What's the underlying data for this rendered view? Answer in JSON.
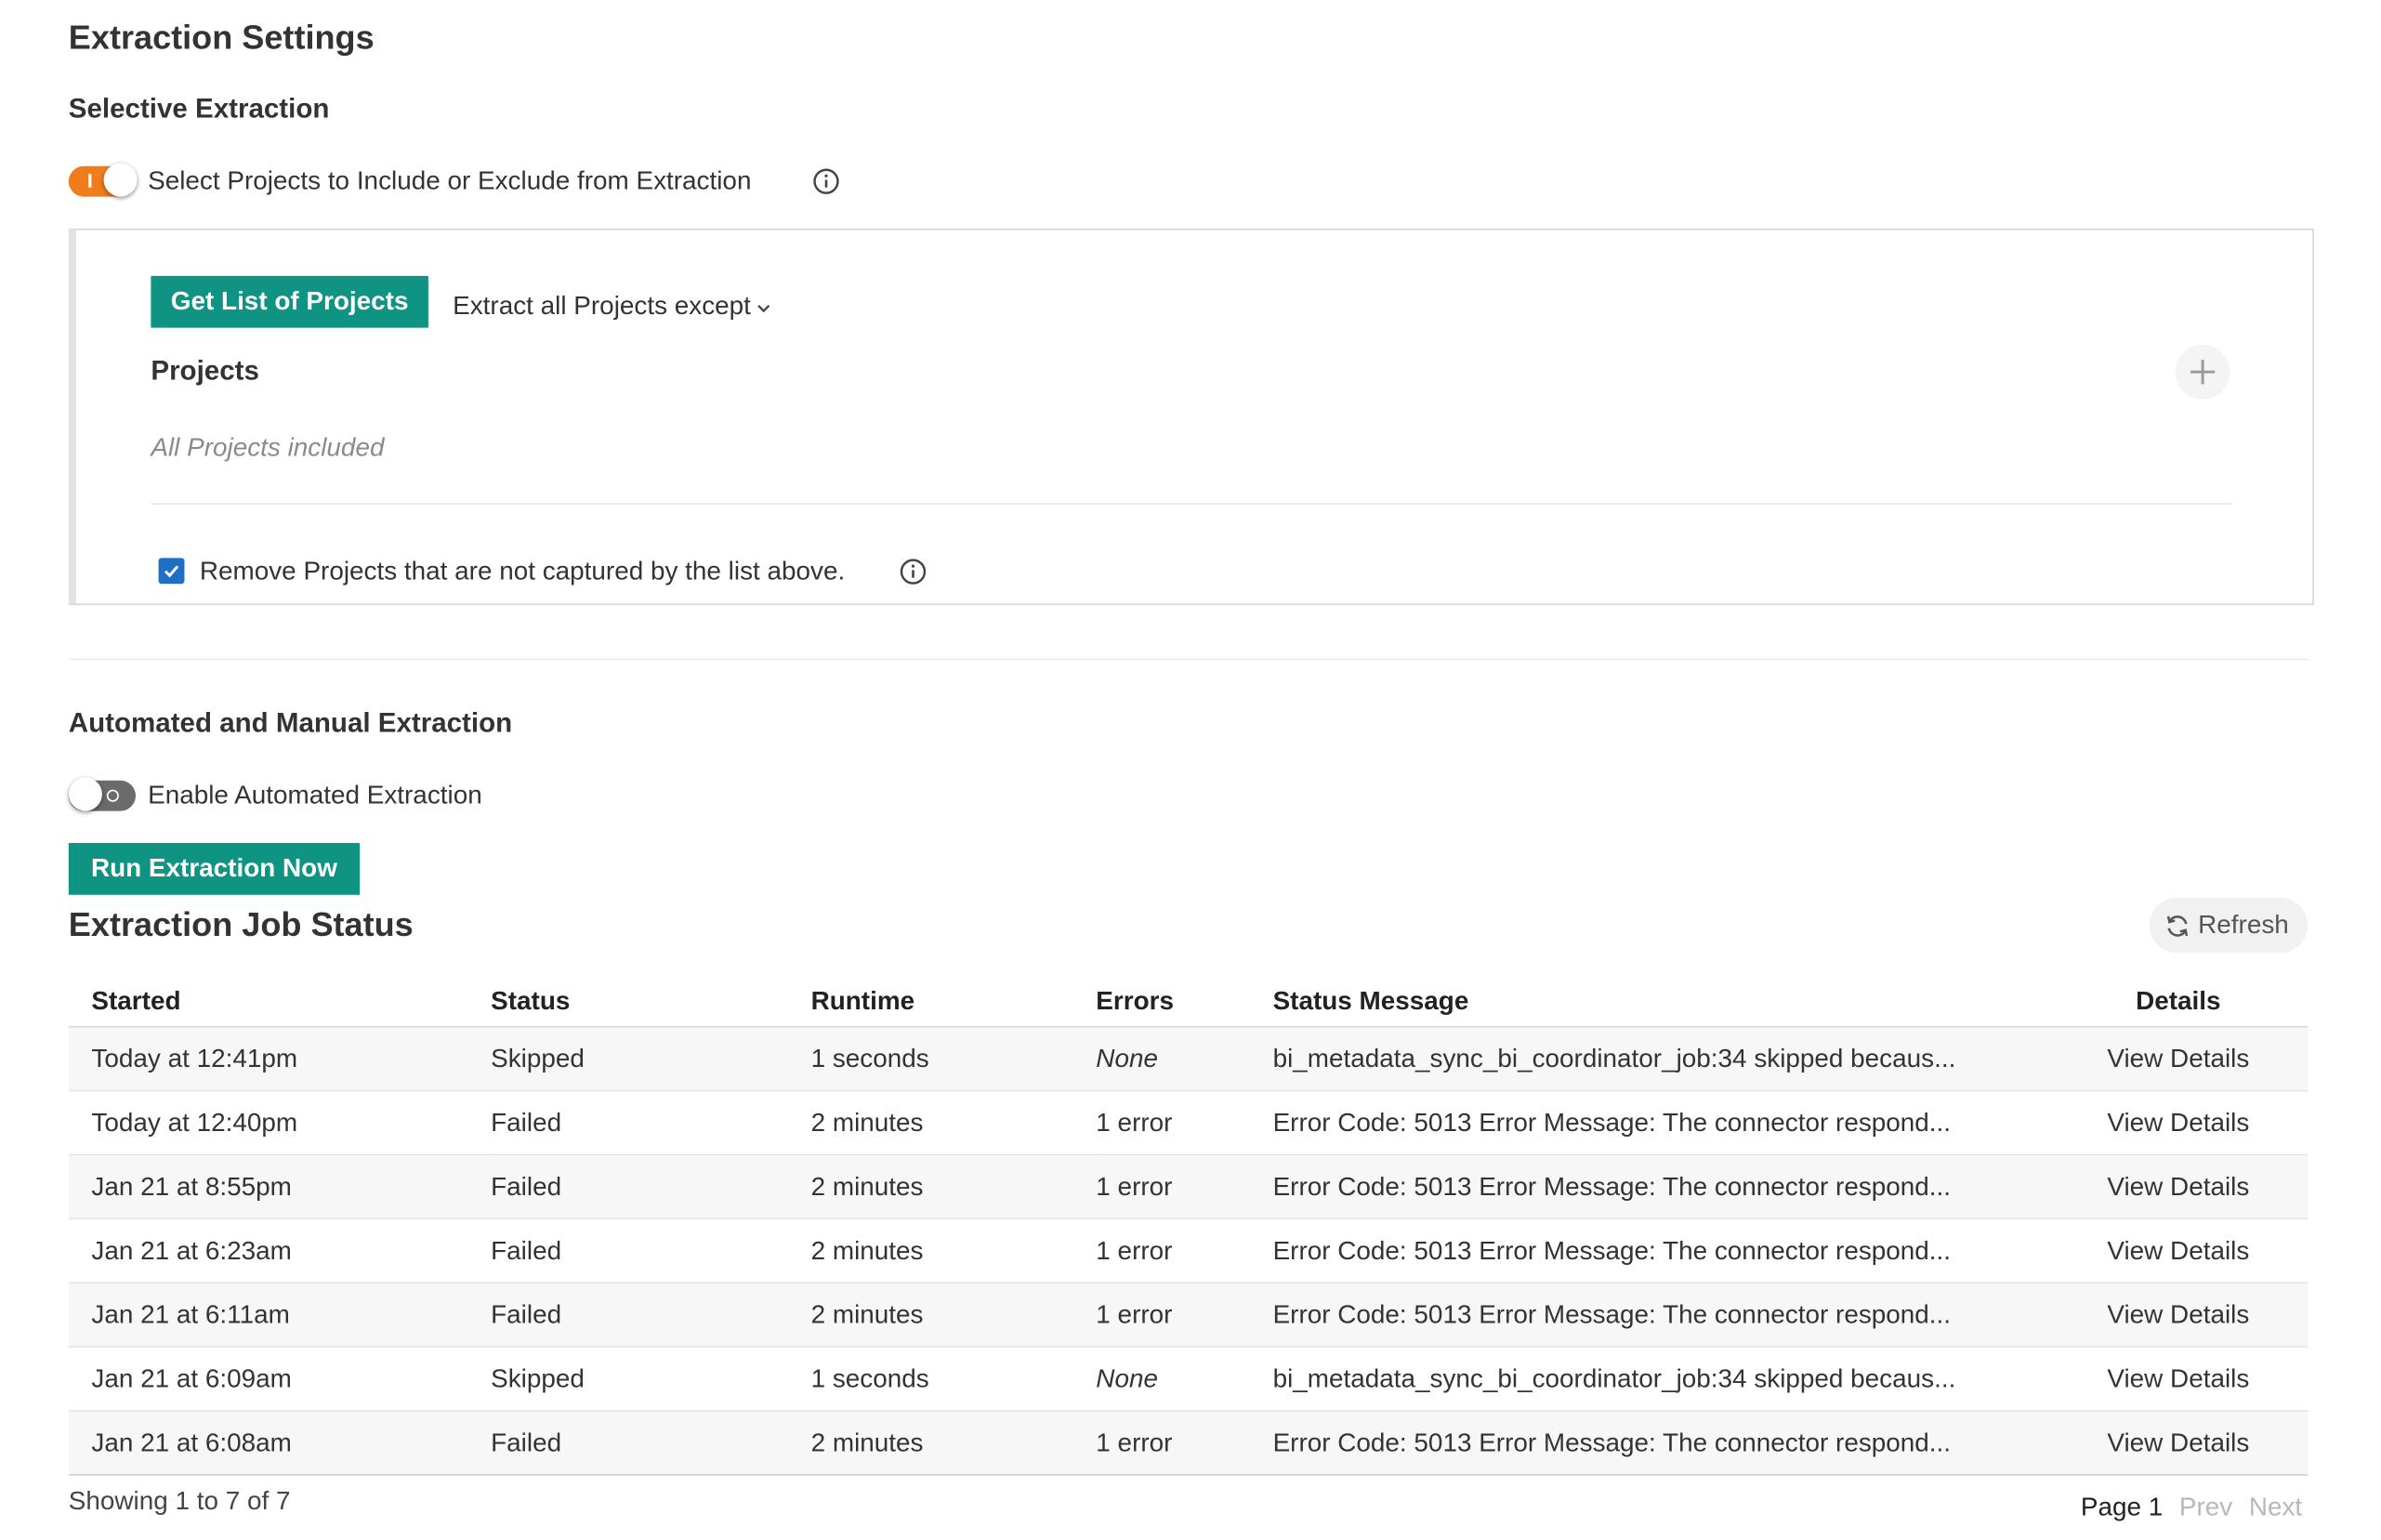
{
  "header": {
    "title": "Extraction Settings"
  },
  "selective": {
    "title": "Selective Extraction",
    "toggle_label": "Select Projects to Include or Exclude from Extraction",
    "toggle_on": true,
    "get_list_label": "Get List of Projects",
    "mode_selected": "Extract all Projects except",
    "projects_heading": "Projects",
    "projects_empty": "All Projects included",
    "remove_checkbox_label": "Remove Projects that are not captured by the list above.",
    "remove_checked": true
  },
  "automated": {
    "title": "Automated and Manual Extraction",
    "toggle_label": "Enable Automated Extraction",
    "toggle_on": false,
    "run_now_label": "Run Extraction Now"
  },
  "jobs": {
    "title": "Extraction Job Status",
    "refresh_label": "Refresh",
    "columns": [
      "Started",
      "Status",
      "Runtime",
      "Errors",
      "Status Message",
      "Details"
    ],
    "rows": [
      {
        "started": "Today at 12:41pm",
        "status": "Skipped",
        "runtime": "1 seconds",
        "errors": "None",
        "message": "bi_metadata_sync_bi_coordinator_job:34 skipped becaus...",
        "details": "View Details"
      },
      {
        "started": "Today at 12:40pm",
        "status": "Failed",
        "runtime": "2 minutes",
        "errors": "1 error",
        "message": "Error Code: 5013 Error Message: The connector respond...",
        "details": "View Details"
      },
      {
        "started": "Jan 21 at 8:55pm",
        "status": "Failed",
        "runtime": "2 minutes",
        "errors": "1 error",
        "message": "Error Code: 5013 Error Message: The connector respond...",
        "details": "View Details"
      },
      {
        "started": "Jan 21 at 6:23am",
        "status": "Failed",
        "runtime": "2 minutes",
        "errors": "1 error",
        "message": "Error Code: 5013 Error Message: The connector respond...",
        "details": "View Details"
      },
      {
        "started": "Jan 21 at 6:11am",
        "status": "Failed",
        "runtime": "2 minutes",
        "errors": "1 error",
        "message": "Error Code: 5013 Error Message: The connector respond...",
        "details": "View Details"
      },
      {
        "started": "Jan 21 at 6:09am",
        "status": "Skipped",
        "runtime": "1 seconds",
        "errors": "None",
        "message": "bi_metadata_sync_bi_coordinator_job:34 skipped becaus...",
        "details": "View Details"
      },
      {
        "started": "Jan 21 at 6:08am",
        "status": "Failed",
        "runtime": "2 minutes",
        "errors": "1 error",
        "message": "Error Code: 5013 Error Message: The connector respond...",
        "details": "View Details"
      }
    ],
    "showing": "Showing 1 to 7 of 7",
    "page_label": "Page 1",
    "prev_label": "Prev",
    "next_label": "Next"
  },
  "colors": {
    "accent_teal": "#0f9484",
    "toggle_on": "#f07c1b",
    "toggle_off": "#6b6b6b",
    "checkbox": "#1e6fc6"
  },
  "icons": {
    "info": "info-icon",
    "plus": "plus-icon",
    "refresh": "refresh-icon",
    "chevron": "chevron-down-icon",
    "check": "checkmark-icon"
  }
}
